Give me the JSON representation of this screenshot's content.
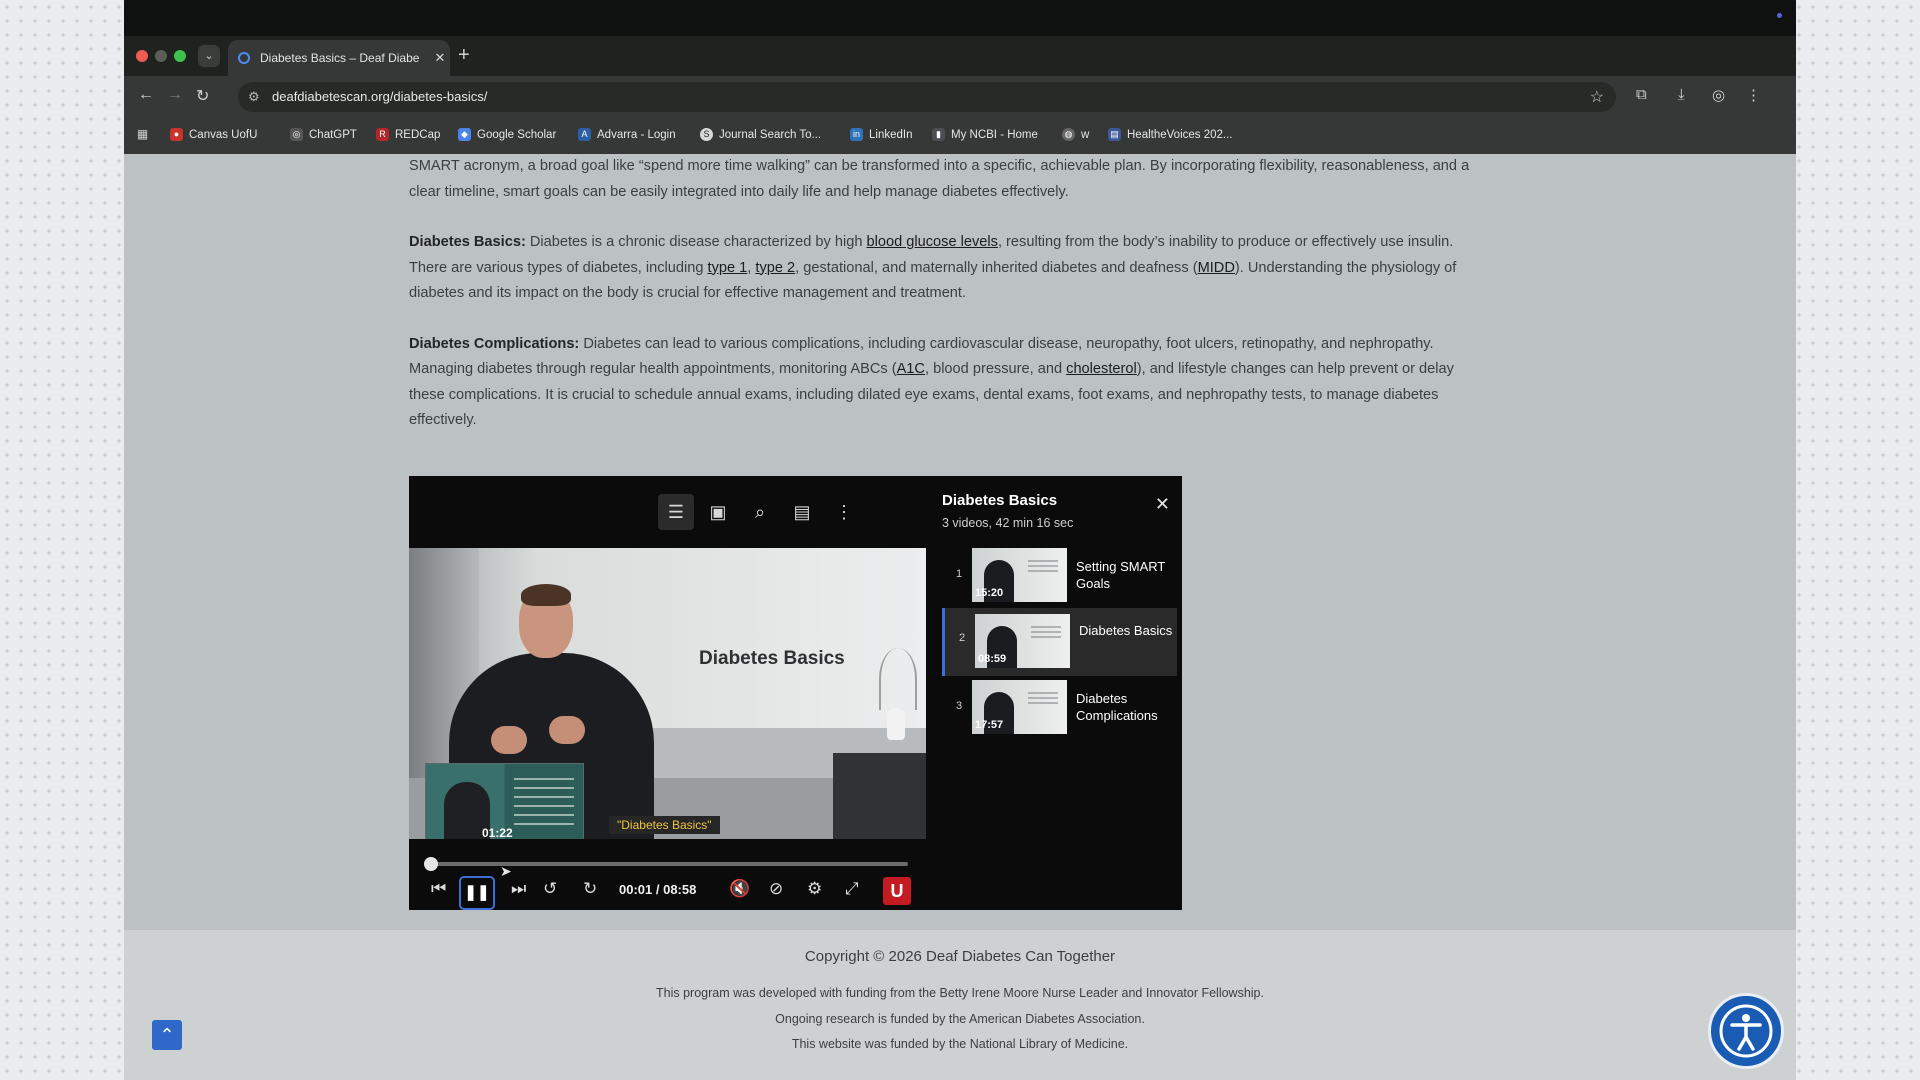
{
  "browser": {
    "tab_title": "Diabetes Basics – Deaf Diabe",
    "url": "deafdiabetescan.org/diabetes-basics/",
    "bookmarks": [
      "Canvas UofU",
      "ChatGPT",
      "REDCap",
      "Google Scholar",
      "Advarra - Login",
      "Journal Search To...",
      "LinkedIn",
      "My NCBI - Home",
      "w",
      "HealtheVoices 202..."
    ]
  },
  "article": {
    "p1_text": "SMART acronym, a broad goal like “spend more time walking” can be transformed into a specific, achievable plan.  By incorporating flexibility, reasonableness, and a clear timeline, smart goals can be easily integrated into daily life and help manage diabetes effectively.",
    "p2_label": "Diabetes Basics:",
    "p2_a": " Diabetes is a chronic disease characterized by high ",
    "p2_link1": "blood glucose levels",
    "p2_b": ", resulting from the body’s inability to produce or effectively use insulin. There are various types of diabetes, including ",
    "p2_link2": "type 1",
    "p2_c": ", ",
    "p2_link3": "type 2",
    "p2_d": ", gestational, and maternally inherited diabetes and deafness (",
    "p2_link4": "MIDD",
    "p2_e": "). Understanding the physiology of diabetes and its impact on the body is crucial for effective management and treatment.",
    "p3_label": "Diabetes Complications:",
    "p3_a": " Diabetes can lead to various complications, including cardiovascular disease, neuropathy, foot ulcers, retinopathy, and nephropathy. Managing diabetes through regular health appointments, monitoring ABCs (",
    "p3_link1": "A1C",
    "p3_b": ", blood pressure, and ",
    "p3_link2": "cholesterol",
    "p3_c": "), and lifestyle changes can help prevent or delay these complications.  It is crucial to schedule annual exams, including dilated eye exams, dental exams, foot exams, and nephropathy tests, to manage diabetes effectively."
  },
  "player": {
    "video_title": "Diabetes Basics",
    "caption": "\"Diabetes Basics\"",
    "preview_time": "01:22",
    "timecode": "00:01 / 08:58",
    "progress_fraction": 0.0,
    "brand_letter": "U",
    "playlist": {
      "title": "Diabetes Basics",
      "subtitle": "3 videos, 42 min 16 sec",
      "items": [
        {
          "num": "1",
          "name": "Setting SMART Goals",
          "duration": "15:20"
        },
        {
          "num": "2",
          "name": "Diabetes Basics",
          "duration": "08:59"
        },
        {
          "num": "3",
          "name": "Diabetes Complications",
          "duration": "17:57"
        }
      ]
    }
  },
  "footer": {
    "copyright": "Copyright © 2026 Deaf Diabetes Can Together",
    "line1": "This program was developed with funding from the Betty Irene Moore Nurse Leader and Innovator Fellowship.",
    "line2": "Ongoing research is funded by the American Diabetes Association.",
    "line3": "This website was funded by the National Library of Medicine."
  },
  "colors": {
    "accent": "#3d6fd8",
    "page_bg": "#bcc2c3",
    "footer_bg": "#cdd1d2",
    "brand_red": "#c41a22"
  }
}
